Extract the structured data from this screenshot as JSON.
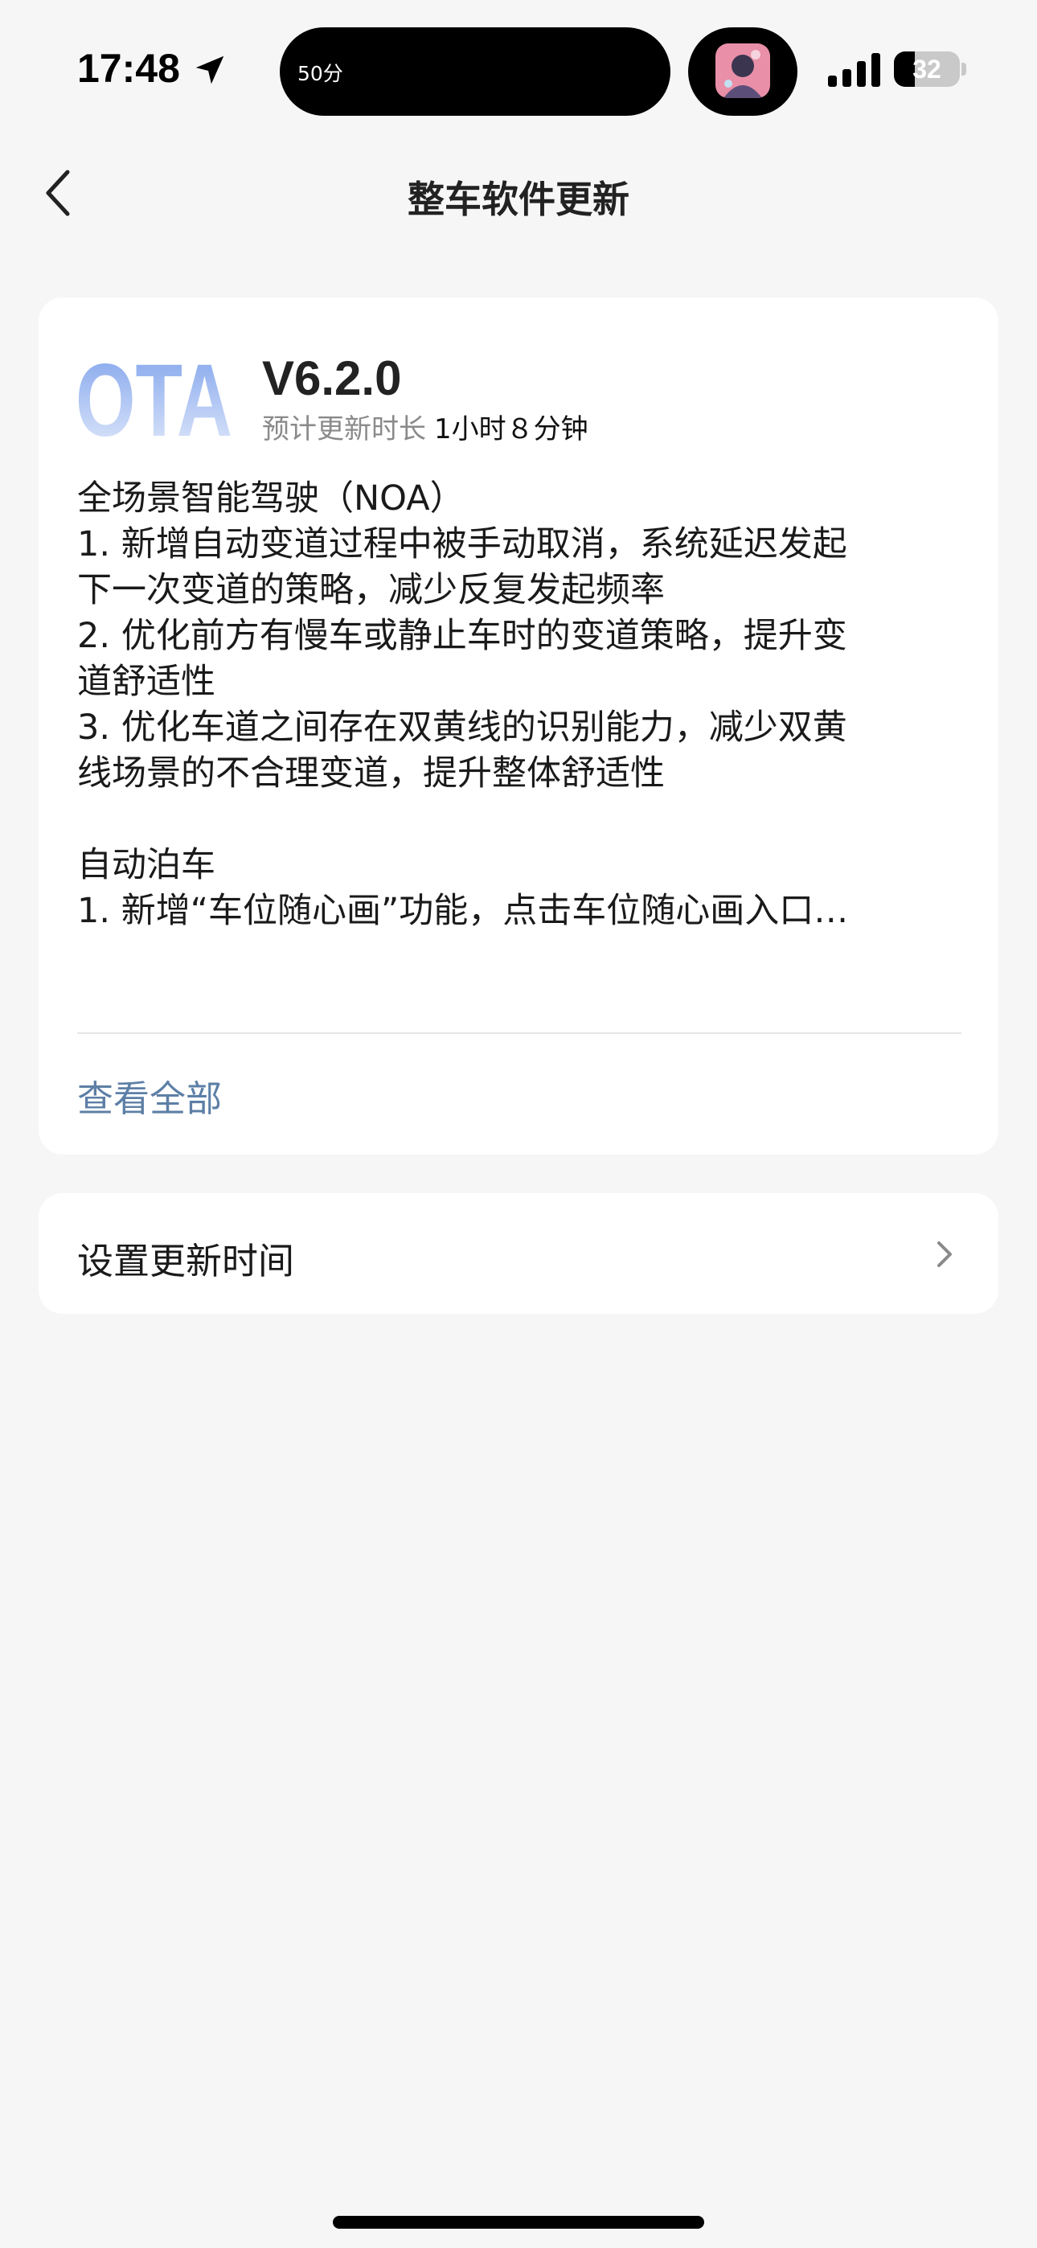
{
  "status_bar": {
    "time": "17:48",
    "island_text": "50分",
    "battery_level": "32",
    "battery_percent": 32
  },
  "nav": {
    "title": "整车软件更新"
  },
  "release": {
    "logo_text": "OTA",
    "version": "V6.2.0",
    "duration_label": "预计更新时长",
    "duration_value": "1小时８分钟",
    "notes": [
      "全场景智能驾驶（NOA）",
      "1. 新增自动变道过程中被手动取消，系统延迟发起",
      "下一次变道的策略，减少反复发起频率",
      "2. 优化前方有慢车或静止车时的变道策略，提升变",
      "道舒适性",
      "3. 优化车道之间存在双黄线的识别能力，减少双黄",
      "线场景的不合理变道，提升整体舒适性",
      "",
      "自动泊车",
      "1. 新增“车位随心画”功能，点击车位随心画入口…"
    ],
    "view_all_label": "查看全部"
  },
  "schedule": {
    "label": "设置更新时间"
  },
  "colors": {
    "background": "#f6f6f6",
    "card": "#ffffff",
    "link": "#5d7fa6",
    "logo_gradient_top": "#7fa2ec",
    "logo_gradient_bottom": "#dfe8fb"
  }
}
